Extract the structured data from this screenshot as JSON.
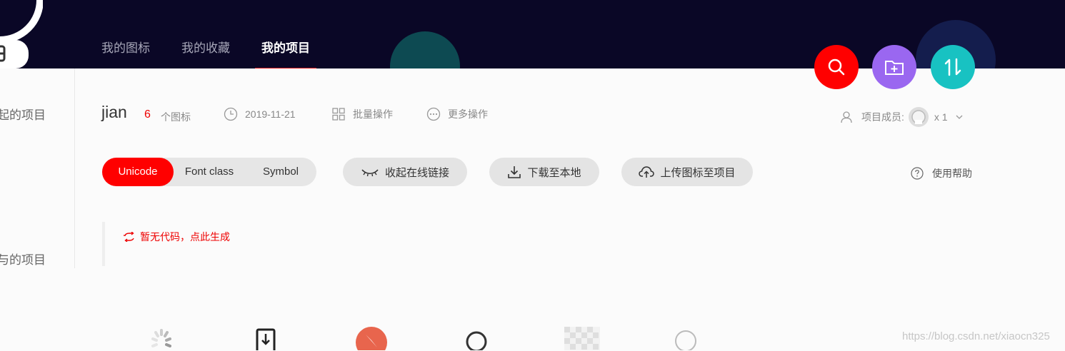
{
  "nav": {
    "items": [
      {
        "label": "我的图标",
        "active": false
      },
      {
        "label": "我的收藏",
        "active": false
      },
      {
        "label": "我的项目",
        "active": true
      }
    ]
  },
  "fabs": {
    "search": "search-icon",
    "add_folder": "folder-add-icon",
    "sort": "sort-icon"
  },
  "sidebar": {
    "item_top": "起的项目",
    "item_bottom": "与的项目"
  },
  "project": {
    "name": "jian",
    "icon_count": "6",
    "icon_count_label": "个图标",
    "date": "2019-11-21",
    "batch_label": "批量操作",
    "more_label": "更多操作",
    "members_label": "项目成员:",
    "members_count": "x 1"
  },
  "tabs": {
    "unicode": "Unicode",
    "font_class": "Font class",
    "symbol": "Symbol",
    "active": "Unicode"
  },
  "actions": {
    "collapse_link": "收起在线链接",
    "download": "下载至本地",
    "upload": "上传图标至项目",
    "help": "使用帮助"
  },
  "code": {
    "generate_label": "暂无代码，点此生成"
  },
  "watermark": "https://blog.csdn.net/xiaocn325",
  "colors": {
    "header_bg": "#0a0726",
    "accent_red": "#ff0000",
    "fab_purple": "#9a67f0",
    "fab_teal": "#18c2c2"
  }
}
